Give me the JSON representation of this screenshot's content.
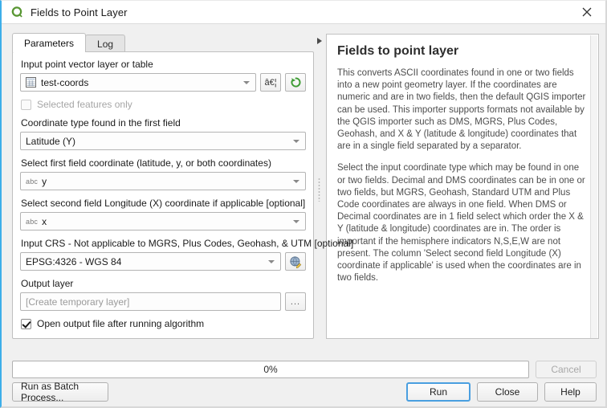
{
  "window": {
    "title": "Fields to Point Layer",
    "logo_icon": "qgis-q-logo-icon",
    "close_icon": "close-icon"
  },
  "tabs": [
    {
      "label": "Parameters",
      "name": "tab-parameters",
      "active": true
    },
    {
      "label": "Log",
      "name": "tab-log",
      "active": false
    }
  ],
  "parameters": {
    "input_layer": {
      "label": "Input point vector layer or table",
      "value": "test-coords",
      "icon": "table-layer-icon",
      "ellipsis_button": "â€¦",
      "refresh_icon": "refresh-green-icon"
    },
    "selected_features": {
      "label": "Selected features only",
      "checked": false,
      "enabled": false
    },
    "coord_type": {
      "label": "Coordinate type found in the first field",
      "value": "Latitude (Y)"
    },
    "first_field": {
      "label": "Select first field coordinate (latitude, y, or both coordinates)",
      "prefix": "abc",
      "value": "y"
    },
    "second_field": {
      "label": "Select second field Longitude (X) coordinate if applicable [optional]",
      "prefix": "abc",
      "value": "x"
    },
    "input_crs": {
      "label": "Input CRS - Not applicable to MGRS, Plus Codes, Geohash, & UTM [optional]",
      "value": "EPSG:4326 - WGS 84",
      "select_icon": "crs-globe-pencil-icon"
    },
    "output_layer": {
      "label": "Output layer",
      "placeholder": "[Create temporary layer]",
      "value": "",
      "browse_label": "..."
    },
    "open_output": {
      "label": "Open output file after running algorithm",
      "checked": true
    }
  },
  "splitter": {
    "collapse_icon": "collapse-arrow-icon",
    "handle_icon": "splitter-handle-icon"
  },
  "help": {
    "title": "Fields to point layer",
    "paragraphs": [
      "This converts ASCII coordinates found in one or two fields into a new point geometry layer. If the coordinates are numeric and are in two fields, then the default QGIS importer can be used. This importer supports formats not available by the QGIS importer such as DMS, MGRS, Plus Codes, Geohash, and X & Y (latitude & longitude) coordinates that are in a single field separated by a separator.",
      "Select the input coordinate type which may be found in one or two fields. Decimal and DMS coordinates can be in one or two fields, but MGRS, Geohash, Standard UTM and Plus Code coordinates are always in one field. When DMS or Decimal coordinates are in 1 field select which order the X & Y (latitude & longitude) coordinates are in. The order is important if the hemisphere indicators N,S,E,W are not present. The column 'Select second field Longitude (X) coordinate if applicable' is used when the coordinates are in two fields."
    ]
  },
  "footer": {
    "progress_text": "0%",
    "progress_value": 0,
    "cancel_label": "Cancel",
    "cancel_enabled": false,
    "batch_label": "Run as Batch Process...",
    "run_label": "Run",
    "close_label": "Close",
    "help_label": "Help"
  },
  "colors": {
    "accent": "#3daee9",
    "qgis_green": "#589632",
    "window_bg": "#f0f0f0",
    "panel_bg": "#ffffff"
  }
}
